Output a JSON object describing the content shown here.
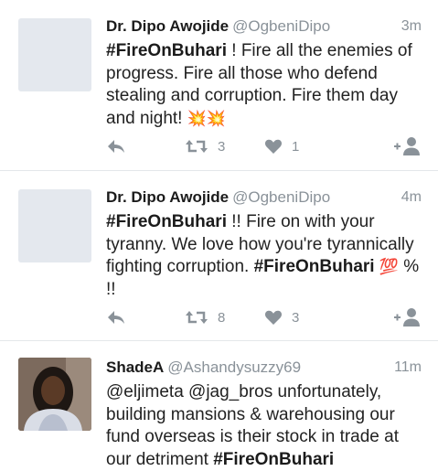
{
  "tweets": [
    {
      "name": "Dr. Dipo Awojide",
      "handle": "@OgbeniDipo",
      "time": "3m",
      "hashtag": "#FireOnBuhari",
      "text": " ! Fire all the enemies of progress. Fire all those who defend stealing and corruption. Fire them day and night! ",
      "emoji": "💥💥",
      "retweets": "3",
      "likes": "1",
      "avatar": "blank"
    },
    {
      "name": "Dr. Dipo Awojide",
      "handle": "@OgbeniDipo",
      "time": "4m",
      "hashtag": "#FireOnBuhari",
      "text": " !! Fire on with your tyranny. We love how you're tyrannically fighting corruption. ",
      "hashtag2": "#FireOnBuhari",
      "emoji": "💯",
      "text2": " % !!",
      "retweets": "8",
      "likes": "3",
      "avatar": "blank"
    },
    {
      "name": "ShadeA",
      "handle": "@Ashandysuzzy69",
      "time": "11m",
      "text": "@eljimeta @jag_bros unfortunately, building mansions & warehousing our fund overseas is their stock in trade at our detriment ",
      "hashtag": "#FireOnBuhari",
      "avatar": "photo"
    }
  ],
  "colors": {
    "secondary_text": "#8a9299",
    "divider": "#e4e7ea",
    "avatar_placeholder": "#e4e8ee"
  },
  "icons": [
    "reply-icon",
    "retweet-icon",
    "like-icon",
    "follow-icon"
  ]
}
